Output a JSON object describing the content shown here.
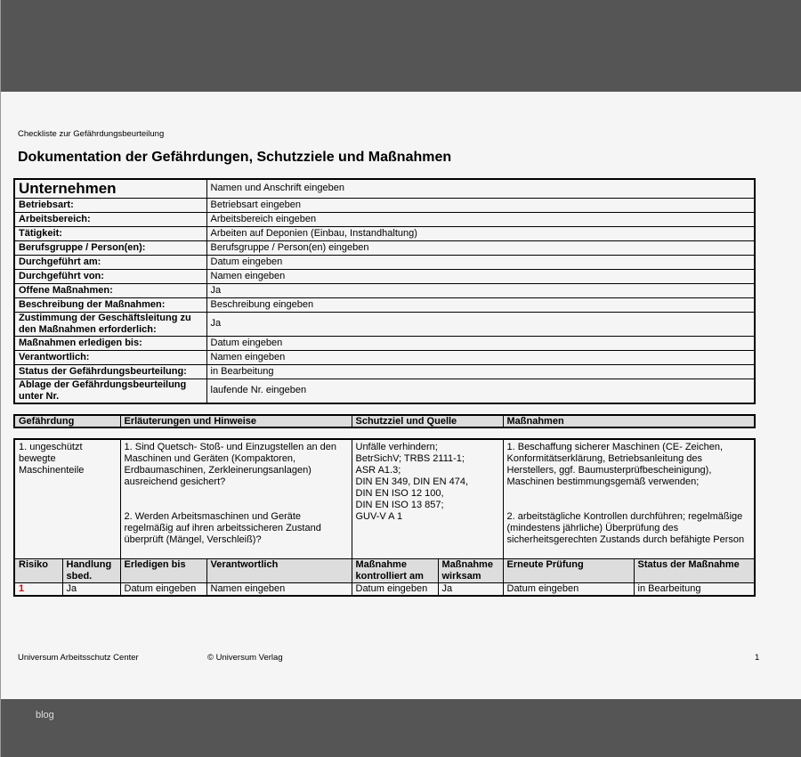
{
  "subtitle": "Checkliste zur Gefährdungsbeurteilung",
  "title": "Dokumentation der Gefährdungen, Schutzziele und Maßnahmen",
  "info": [
    {
      "k": "Unternehmen",
      "v": "Namen und Anschrift eingeben"
    },
    {
      "k": "Betriebsart:",
      "v": "Betriebsart eingeben"
    },
    {
      "k": "Arbeitsbereich:",
      "v": "Arbeitsbereich eingeben"
    },
    {
      "k": "Tätigkeit:",
      "v": "Arbeiten auf Deponien (Einbau, Instandhaltung)"
    },
    {
      "k": "Berufsgruppe / Person(en):",
      "v": "Berufsgruppe / Person(en) eingeben"
    },
    {
      "k": "Durchgeführt am:",
      "v": "Datum eingeben"
    },
    {
      "k": "Durchgeführt von:",
      "v": "Namen eingeben"
    },
    {
      "k": "Offene Maßnahmen:",
      "v": "Ja"
    },
    {
      "k": "Beschreibung der Maßnahmen:",
      "v": "Beschreibung eingeben"
    },
    {
      "k": "Zustimmung der Geschäftsleitung zu den Maßnahmen erforderlich:",
      "v": "Ja"
    },
    {
      "k": "Maßnahmen erledigen bis:",
      "v": "Datum eingeben"
    },
    {
      "k": "Verantwortlich:",
      "v": "Namen eingeben"
    },
    {
      "k": "Status der Gefährdungsbeurteilung:",
      "v": "in Bearbeitung"
    },
    {
      "k": "Ablage der Gefährdungsbeurteilung unter Nr.",
      "v": "laufende Nr. eingeben"
    }
  ],
  "headers": [
    "Gefährdung",
    "Erläuterungen und Hinweise",
    "Schutzziel und Quelle",
    "Maßnahmen"
  ],
  "row": {
    "gefaehrdung": "1. ungeschützt bewegte Maschinenteile",
    "hinweise1": "1. Sind Quetsch- Stoß- und Einzugstellen an den Maschinen und Geräten (Kompaktoren, Erdbaumaschinen, Zerkleinerungsanlagen) ausreichend gesichert?",
    "hinweise2": "2. Werden Arbeitsmaschinen und Geräte regelmäßig auf ihren arbeitssicheren Zustand überprüft (Mängel, Verschleiß)?",
    "schutzziel": "Unfälle verhindern;\nBetrSichV; TRBS 2111-1;\nASR A1.3;\nDIN EN 349, DIN EN 474,\nDIN EN ISO 12 100,\nDIN EN ISO 13 857;\nGUV-V A 1",
    "massnahmen1": "1. Beschaffung sicherer Maschinen (CE- Zeichen, Konformitätserklärung, Betriebsanleitung des Herstellers, ggf. Baumusterprüfbescheinigung), Maschinen bestimmungsgemäß verwenden;",
    "massnahmen2": "2. arbeitstägliche Kontrollen durchführen; regelmäßige (mindestens jährliche) Überprüfung des sicherheitsgerechten Zustands durch befähigte Person"
  },
  "subheaders": [
    "Risiko",
    "Handlung sbed.",
    "Erledigen bis",
    "Verantwortlich",
    "Maßnahme kontrolliert am",
    "Maßnahme wirksam",
    "Erneute Prüfung",
    "Status der Maßnahme"
  ],
  "subvalues": [
    "1",
    "Ja",
    "Datum eingeben",
    "Namen eingeben",
    "Datum eingeben",
    "Ja",
    "Datum eingeben",
    "in Bearbeitung"
  ],
  "footer": {
    "left": "Universum Arbeitsschutz Center",
    "center": "© Universum Verlag",
    "page": "1"
  },
  "blog": "blog",
  "colors": {
    "bar": "#555555",
    "header": "#dddddd",
    "risk": "#dd0000"
  }
}
